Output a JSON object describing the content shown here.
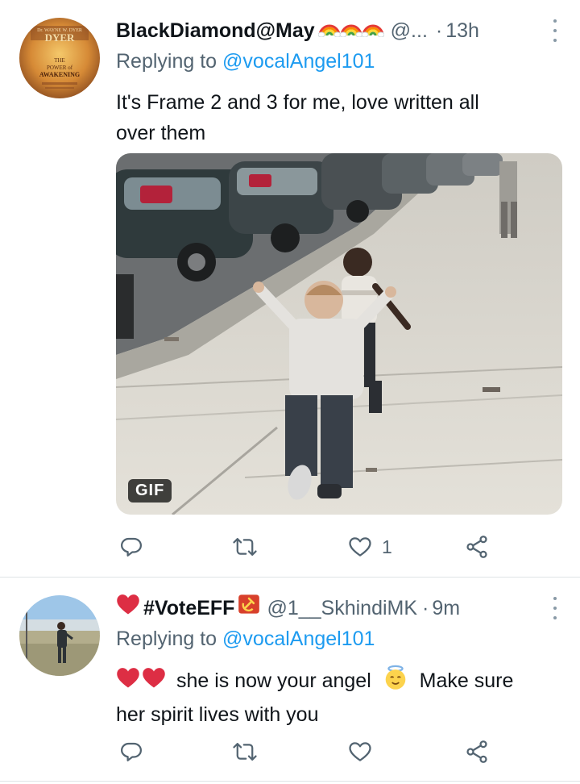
{
  "tweets": [
    {
      "name": "BlackDiamond@May",
      "handle": "@...",
      "time_sep": "·",
      "time": "13h",
      "reply_prefix": "Replying to ",
      "reply_to": "@vocalAngel101",
      "text_line1": "It's Frame 2 and 3 for me, love written all",
      "text_line2": "over them",
      "avatar_book": {
        "author": "Dr. WAYNE W. DYER",
        "title_line1": "THE",
        "title_line2": "POWER of",
        "title_line3": "AWAKENING"
      },
      "media_badge": "GIF",
      "actions": {
        "reply_icon": "reply-icon",
        "retweet_icon": "retweet-icon",
        "like_icon": "heart-icon",
        "like_count": "1",
        "share_icon": "share-icon"
      }
    },
    {
      "name": "#VoteEFF",
      "handle": "@1__SkhindiMK",
      "time_sep": "·",
      "time": "9m",
      "reply_prefix": "Replying to ",
      "reply_to": "@vocalAngel101",
      "text_part1": "she is now your angel",
      "text_part2": "Make sure",
      "text_line2": "her spirit lives with you",
      "actions": {
        "reply_icon": "reply-icon",
        "retweet_icon": "retweet-icon",
        "like_icon": "heart-icon",
        "like_count": "",
        "share_icon": "share-icon"
      }
    }
  ],
  "colors": {
    "link": "#1d9bf0",
    "secondary_text": "#536471",
    "heart": "#e0245e"
  }
}
